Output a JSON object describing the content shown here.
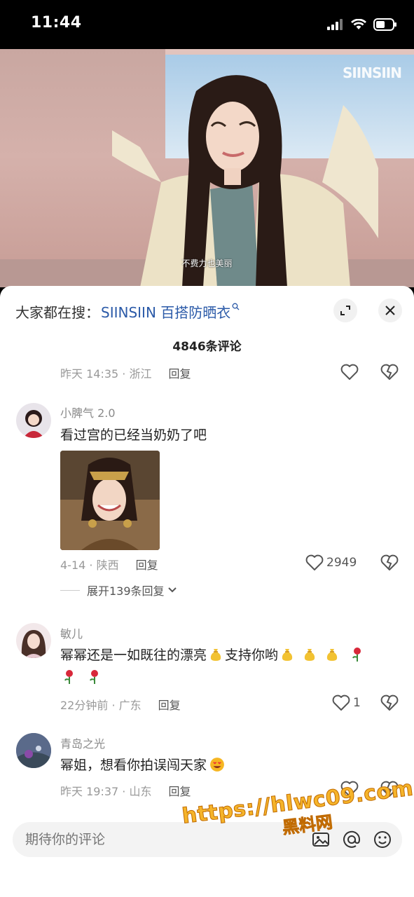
{
  "status_bar": {
    "time": "11:44"
  },
  "video": {
    "logo": "SIINSIIN",
    "subtitle": "不费力也美丽"
  },
  "search": {
    "prefix": "大家都在搜：",
    "term": "SIINSIIN 百搭防晒衣"
  },
  "comments_header": {
    "count_text": "4846条评论"
  },
  "top_comment_meta": {
    "time_location": "昨天 14:35 · 浙江",
    "reply": "回复"
  },
  "comments": [
    {
      "username": "小脾气 2.0",
      "text": "看过宫的已经当奶奶了吧",
      "time_location": "4-14 · 陕西",
      "reply": "回复",
      "likes": "2949",
      "expand_replies": "展开139条回复"
    },
    {
      "username": "敏儿",
      "text_part1": "幂幂还是一如既往的漂亮",
      "text_part2": "支持你哟",
      "time_location": "22分钟前 · 广东",
      "reply": "回复",
      "likes": "1"
    },
    {
      "username": "青岛之光",
      "text": "幂姐，想看你拍误闯天家",
      "time_location": "昨天 19:37 · 山东",
      "reply": "回复"
    }
  ],
  "composer": {
    "placeholder": "期待你的评论"
  },
  "watermark": {
    "url": "https://hlwc09.com",
    "site": "黑料网"
  },
  "colors": {
    "link": "#2b5aa8",
    "watermark": "#f5b42a"
  }
}
